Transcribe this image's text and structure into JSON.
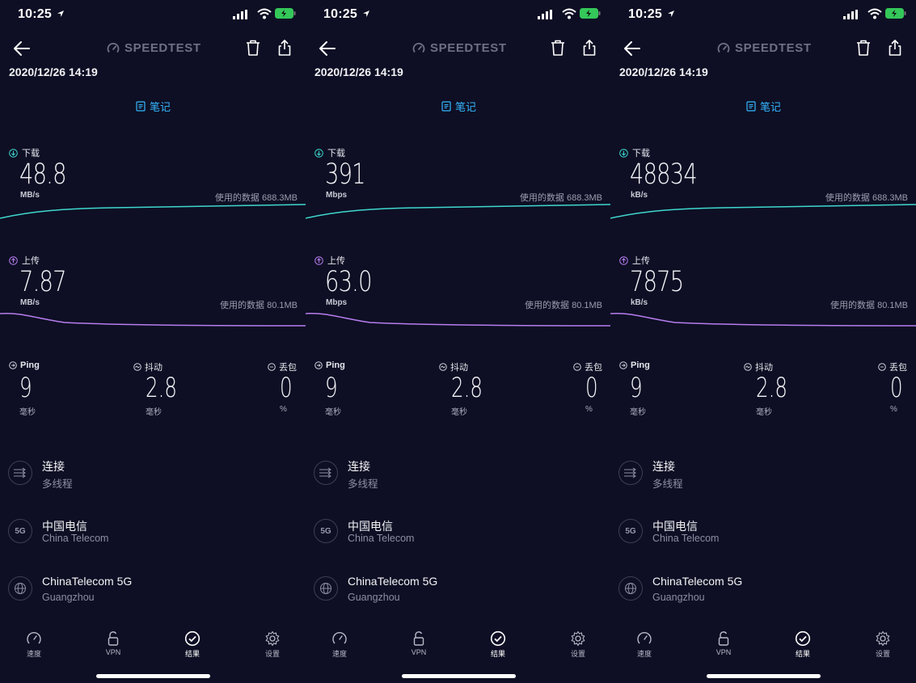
{
  "status_bar": {
    "time": "10:25"
  },
  "header": {
    "logo_text": "SPEEDTEST",
    "timestamp": "2020/12/26 14:19",
    "notes_label": "笔记"
  },
  "labels": {
    "download": "下载",
    "upload": "上传",
    "ping": "Ping",
    "jitter": "抖动",
    "loss": "丢包",
    "ms_unit": "毫秒",
    "percent_unit": "%"
  },
  "screens": [
    {
      "download": {
        "value": "48.8",
        "unit": "MB/s",
        "data_used": "使用的数据 688.3MB"
      },
      "upload": {
        "value": "7.87",
        "unit": "MB/s",
        "data_used": "使用的数据 80.1MB"
      },
      "ping": "9",
      "jitter": "2.8",
      "loss": "0"
    },
    {
      "download": {
        "value": "391",
        "unit": "Mbps",
        "data_used": "使用的数据 688.3MB"
      },
      "upload": {
        "value": "63.0",
        "unit": "Mbps",
        "data_used": "使用的数据 80.1MB"
      },
      "ping": "9",
      "jitter": "2.8",
      "loss": "0"
    },
    {
      "download": {
        "value": "48834",
        "unit": "kB/s",
        "data_used": "使用的数据 688.3MB"
      },
      "upload": {
        "value": "7875",
        "unit": "kB/s",
        "data_used": "使用的数据 80.1MB"
      },
      "ping": "9",
      "jitter": "2.8",
      "loss": "0"
    }
  ],
  "info": {
    "connection_title": "连接",
    "connection_value": "多线程",
    "provider_title": "中国电信",
    "provider_value": "China Telecom",
    "provider_badge": "5G",
    "server_title": "ChinaTelecom 5G",
    "server_value": "Guangzhou"
  },
  "tabbar": {
    "speed": "速度",
    "vpn": "VPN",
    "results": "结果",
    "settings": "设置"
  },
  "colors": {
    "accent": "#36b6ff",
    "download": "#3fd7cf",
    "upload": "#b77df0",
    "background": "#0e0f24"
  },
  "icons": {
    "download": "arrow-down-circle-icon",
    "upload": "arrow-up-circle-icon",
    "ping": "ping-icon",
    "jitter": "jitter-icon",
    "loss": "loss-icon",
    "connection": "multi-connection-icon",
    "server": "globe-icon",
    "back": "arrow-left-icon",
    "delete": "trash-icon",
    "share": "share-icon"
  }
}
